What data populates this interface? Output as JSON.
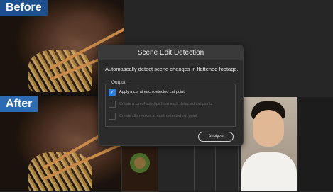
{
  "before_panel": {
    "label": "Before"
  },
  "after_panel": {
    "label": "After"
  },
  "dialog": {
    "title": "Scene Edit Detection",
    "description": "Automatically detect scene changes in flattened footage.",
    "output_group": {
      "legend": "Output",
      "options": [
        {
          "label": "Apply a cut at each detected cut point",
          "checked": true,
          "enabled": true
        },
        {
          "label": "Create a bin of subclips from each detected cut points",
          "checked": false,
          "enabled": false
        },
        {
          "label": "Create clip marker at each detected cut point",
          "checked": false,
          "enabled": false
        }
      ]
    },
    "analyze_button": "Analyze"
  },
  "colors": {
    "accent": "#2f7be0",
    "label_before": "#1d4f8f",
    "label_after": "#2d6bb3"
  }
}
